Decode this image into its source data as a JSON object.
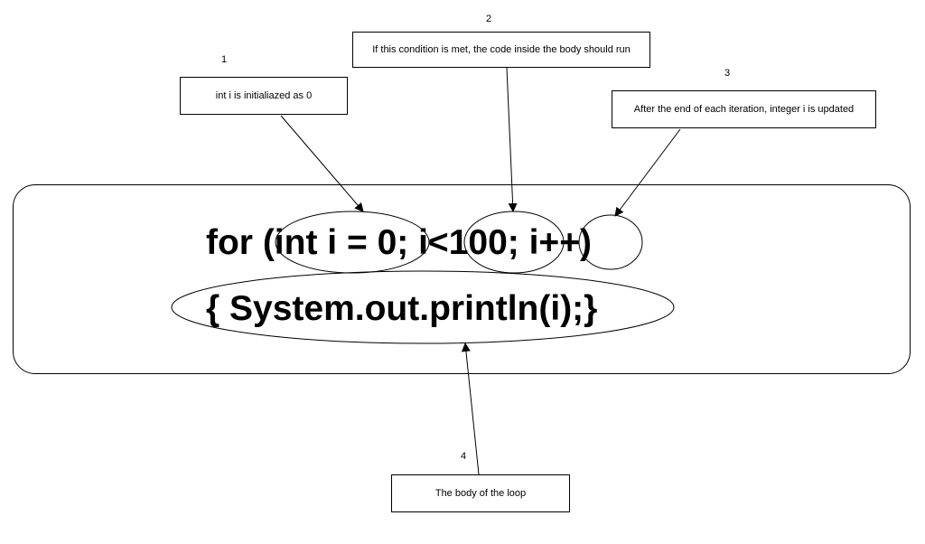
{
  "code": {
    "line1": "for (int i = 0; i<100; i++)",
    "line2": "{ System.out.println(i);}"
  },
  "annotations": {
    "one": {
      "label": "1",
      "text": "int i is initialiazed as 0"
    },
    "two": {
      "label": "2",
      "text": "If this condition is met, the code inside the body should run"
    },
    "three": {
      "label": "3",
      "text": "After the end of each iteration, integer i is updated"
    },
    "four": {
      "label": "4",
      "text": "The body of the loop"
    }
  }
}
